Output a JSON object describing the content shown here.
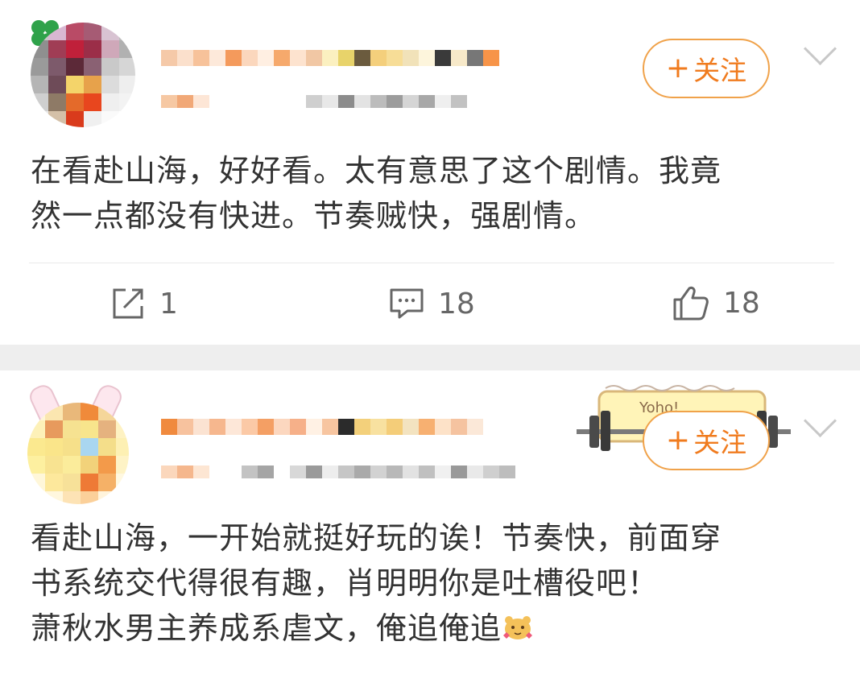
{
  "posts": [
    {
      "follow_label": "关注",
      "follow_plus": "+",
      "content_lines": [
        "在看赴山海，好好看。太有意思了这个剧情。我竟",
        "然一点都没有快进。节奏贼快，强剧情。"
      ],
      "actions": {
        "repost_count": "1",
        "comment_count": "18",
        "like_count": "18"
      }
    },
    {
      "follow_label": "关注",
      "follow_plus": "+",
      "content_lines": [
        "看赴山海，一开始就挺好玩的诶！节奏快，前面穿",
        "书系统交代得很有趣，肖明明你是吐槽役吧！",
        "萧秋水男主养成系虐文，俺追俺追"
      ],
      "emoji": "hamster-emoji",
      "badge_text": "Yoho!"
    }
  ],
  "colors": {
    "accent": "#f07b1e",
    "follow_border": "#f0a24a",
    "separator": "#eeeeee",
    "icon": "#666666"
  },
  "icons": [
    "repost-icon",
    "comment-icon",
    "like-icon",
    "chevron-down-icon"
  ]
}
